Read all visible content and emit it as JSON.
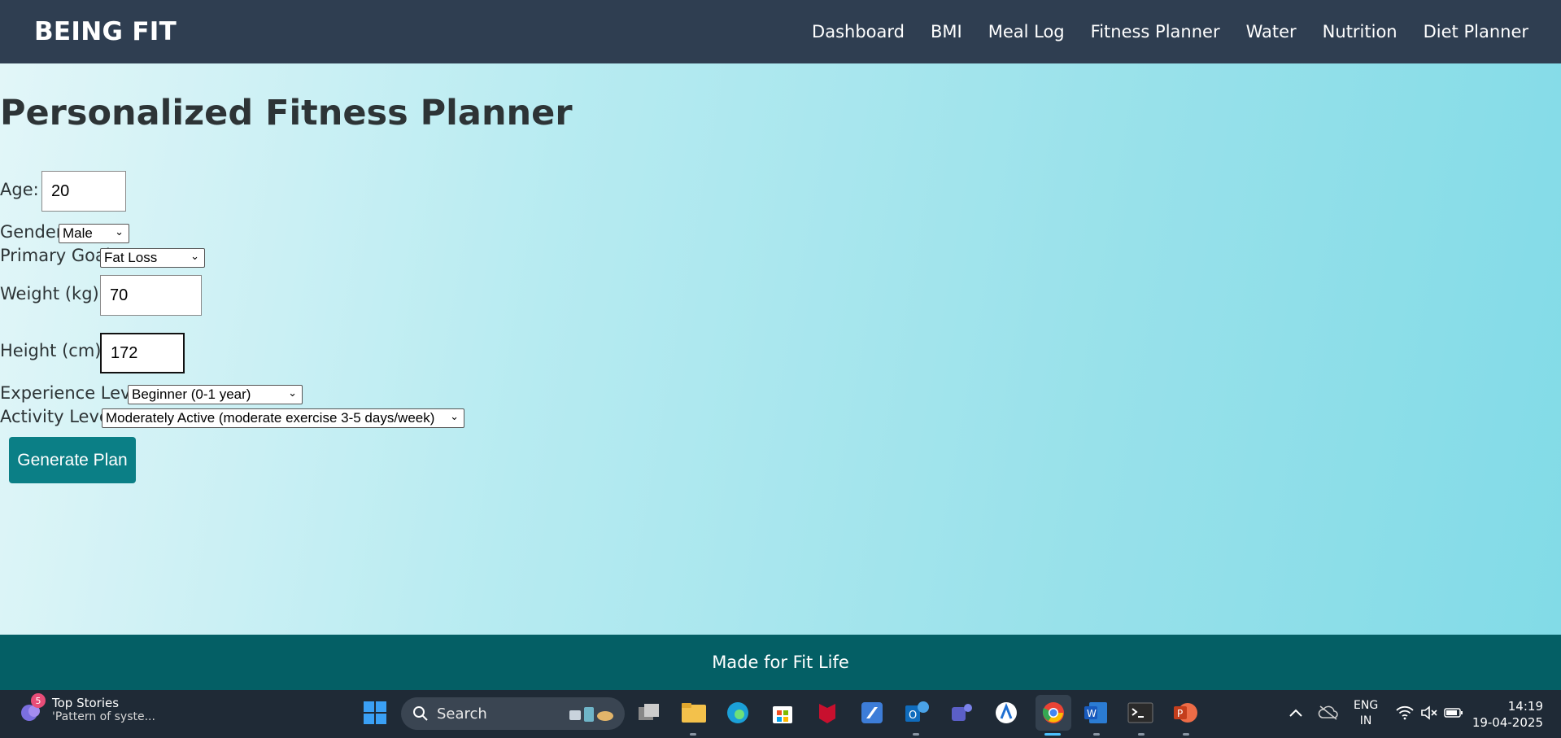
{
  "header": {
    "brand": "BEING FIT",
    "nav": [
      "Dashboard",
      "BMI",
      "Meal Log",
      "Fitness Planner",
      "Water",
      "Nutrition",
      "Diet Planner"
    ]
  },
  "main": {
    "title": "Personalized Fitness Planner",
    "form": {
      "age_label": "Age:",
      "age_value": "20",
      "gender_label": "Gender:",
      "gender_value": "Male",
      "goal_label": "Primary Goal:",
      "goal_value": "Fat Loss",
      "weight_label": "Weight (kg):",
      "weight_value": "70",
      "height_label": "Height (cm):",
      "height_value": "172",
      "experience_label": "Experience Level:",
      "experience_value": "Beginner (0-1 year)",
      "activity_label": "Activity Level:",
      "activity_value": "Moderately Active (moderate exercise 3-5 days/week)",
      "submit_label": "Generate Plan"
    }
  },
  "footer": {
    "text": "Made for Fit Life"
  },
  "taskbar": {
    "news_badge": "5",
    "news_title": "Top Stories",
    "news_subtitle": "'Pattern of syste...",
    "search_label": "Search",
    "lang_line1": "ENG",
    "lang_line2": "IN",
    "time": "14:19",
    "date": "19-04-2025"
  },
  "colors": {
    "header_bg": "#2f3e51",
    "accent": "#0b7f86",
    "footer_bg": "#045f65",
    "taskbar_bg": "#1f2a36"
  }
}
